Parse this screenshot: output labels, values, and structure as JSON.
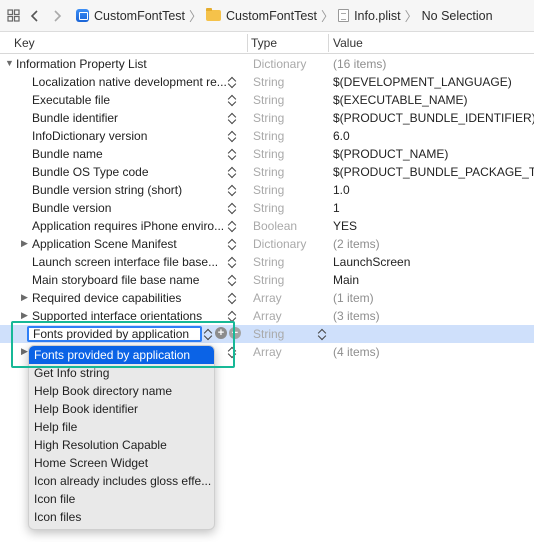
{
  "jumpbar": {
    "crumbs": [
      {
        "label": "CustomFontTest",
        "icon": "project-icon"
      },
      {
        "label": "CustomFontTest",
        "icon": "folder-icon"
      },
      {
        "label": "Info.plist",
        "icon": "plist-file-icon"
      },
      {
        "label": "No Selection",
        "icon": ""
      }
    ]
  },
  "columns": {
    "key": "Key",
    "type": "Type",
    "value": "Value"
  },
  "rows": [
    {
      "key": "Information Property List",
      "type": "Dictionary",
      "value": "(16 items)",
      "disclosure": "open",
      "indent": 0
    },
    {
      "key": "Localization native development re...",
      "type": "String",
      "value": "$(DEVELOPMENT_LANGUAGE)",
      "indent": 1
    },
    {
      "key": "Executable file",
      "type": "String",
      "value": "$(EXECUTABLE_NAME)",
      "indent": 1
    },
    {
      "key": "Bundle identifier",
      "type": "String",
      "value": "$(PRODUCT_BUNDLE_IDENTIFIER)",
      "indent": 1
    },
    {
      "key": "InfoDictionary version",
      "type": "String",
      "value": "6.0",
      "indent": 1
    },
    {
      "key": "Bundle name",
      "type": "String",
      "value": "$(PRODUCT_NAME)",
      "indent": 1
    },
    {
      "key": "Bundle OS Type code",
      "type": "String",
      "value": "$(PRODUCT_BUNDLE_PACKAGE_TYPE",
      "indent": 1
    },
    {
      "key": "Bundle version string (short)",
      "type": "String",
      "value": "1.0",
      "indent": 1
    },
    {
      "key": "Bundle version",
      "type": "String",
      "value": "1",
      "indent": 1
    },
    {
      "key": "Application requires iPhone enviro...",
      "type": "Boolean",
      "value": "YES",
      "indent": 1
    },
    {
      "key": "Application Scene Manifest",
      "type": "Dictionary",
      "value": "(2 items)",
      "disclosure": "closed",
      "indent": 1
    },
    {
      "key": "Launch screen interface file base...",
      "type": "String",
      "value": "LaunchScreen",
      "indent": 1
    },
    {
      "key": "Main storyboard file base name",
      "type": "String",
      "value": "Main",
      "indent": 1
    },
    {
      "key": "Required device capabilities",
      "type": "Array",
      "value": "(1 item)",
      "disclosure": "closed",
      "indent": 1
    },
    {
      "key": "Supported interface orientations",
      "type": "Array",
      "value": "(3 items)",
      "disclosure": "closed",
      "indent": 1
    },
    {
      "key": "Fonts provided by application",
      "type": "String",
      "value": "",
      "editing": true,
      "indent": 1
    },
    {
      "key": "",
      "type": "Array",
      "value": "(4 items)",
      "disclosure": "closed",
      "indent": 1
    }
  ],
  "dropdown": {
    "items": [
      "Fonts provided by application",
      "Get Info string",
      "Help Book directory name",
      "Help Book identifier",
      "Help file",
      "High Resolution Capable",
      "Home Screen Widget",
      "Icon already includes gloss effe...",
      "Icon file",
      "Icon files"
    ],
    "selected_index": 0
  },
  "colors": {
    "selection": "#0b63e6",
    "row_highlight": "#cfe0fb",
    "callout": "#17b897"
  }
}
